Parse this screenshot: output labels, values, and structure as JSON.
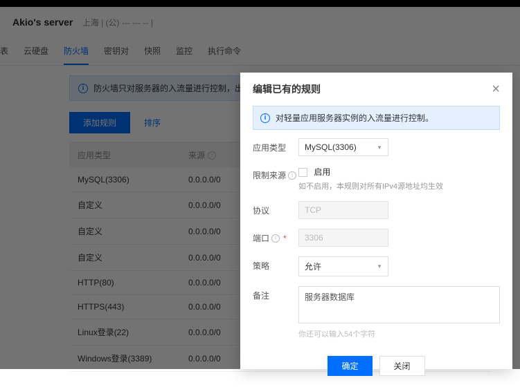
{
  "header": {
    "title": "Akio's server",
    "sub": "上海 | (公) --- --- -- |"
  },
  "tabs": [
    "表",
    "云硬盘",
    "防火墙",
    "密钥对",
    "快照",
    "监控",
    "执行命令"
  ],
  "activeTab": 2,
  "notice": "防火墙只对服务器的入流量进行控制，出流量默",
  "buttons": {
    "add": "添加规则",
    "sort": "排序"
  },
  "table": {
    "cols": {
      "app": "应用类型",
      "src": "来源"
    },
    "rows": [
      {
        "app": "MySQL(3306)",
        "src": "0.0.0.0/0"
      },
      {
        "app": "自定义",
        "src": "0.0.0.0/0"
      },
      {
        "app": "自定义",
        "src": "0.0.0.0/0"
      },
      {
        "app": "自定义",
        "src": "0.0.0.0/0"
      },
      {
        "app": "HTTP(80)",
        "src": "0.0.0.0/0"
      },
      {
        "app": "HTTPS(443)",
        "src": "0.0.0.0/0"
      },
      {
        "app": "Linux登录(22)",
        "src": "0.0.0.0/0"
      },
      {
        "app": "Windows登录(3389)",
        "src": "0.0.0.0/0"
      }
    ]
  },
  "modal": {
    "title": "编辑已有的规则",
    "notice": "对轻量应用服务器实例的入流量进行控制。",
    "labels": {
      "appType": "应用类型",
      "restrictSrc": "限制来源",
      "enable": "启用",
      "srcHint": "如不启用，本规则对所有IPv4源地址均生效",
      "protocol": "协议",
      "port": "端口",
      "policy": "策略",
      "remark": "备注"
    },
    "values": {
      "appType": "MySQL(3306)",
      "protocol": "TCP",
      "port": "3306",
      "policy": "允许",
      "remark": "服务器数据库"
    },
    "countHint": "你还可以输入54个字符",
    "buttons": {
      "ok": "确定",
      "close": "关闭"
    }
  }
}
